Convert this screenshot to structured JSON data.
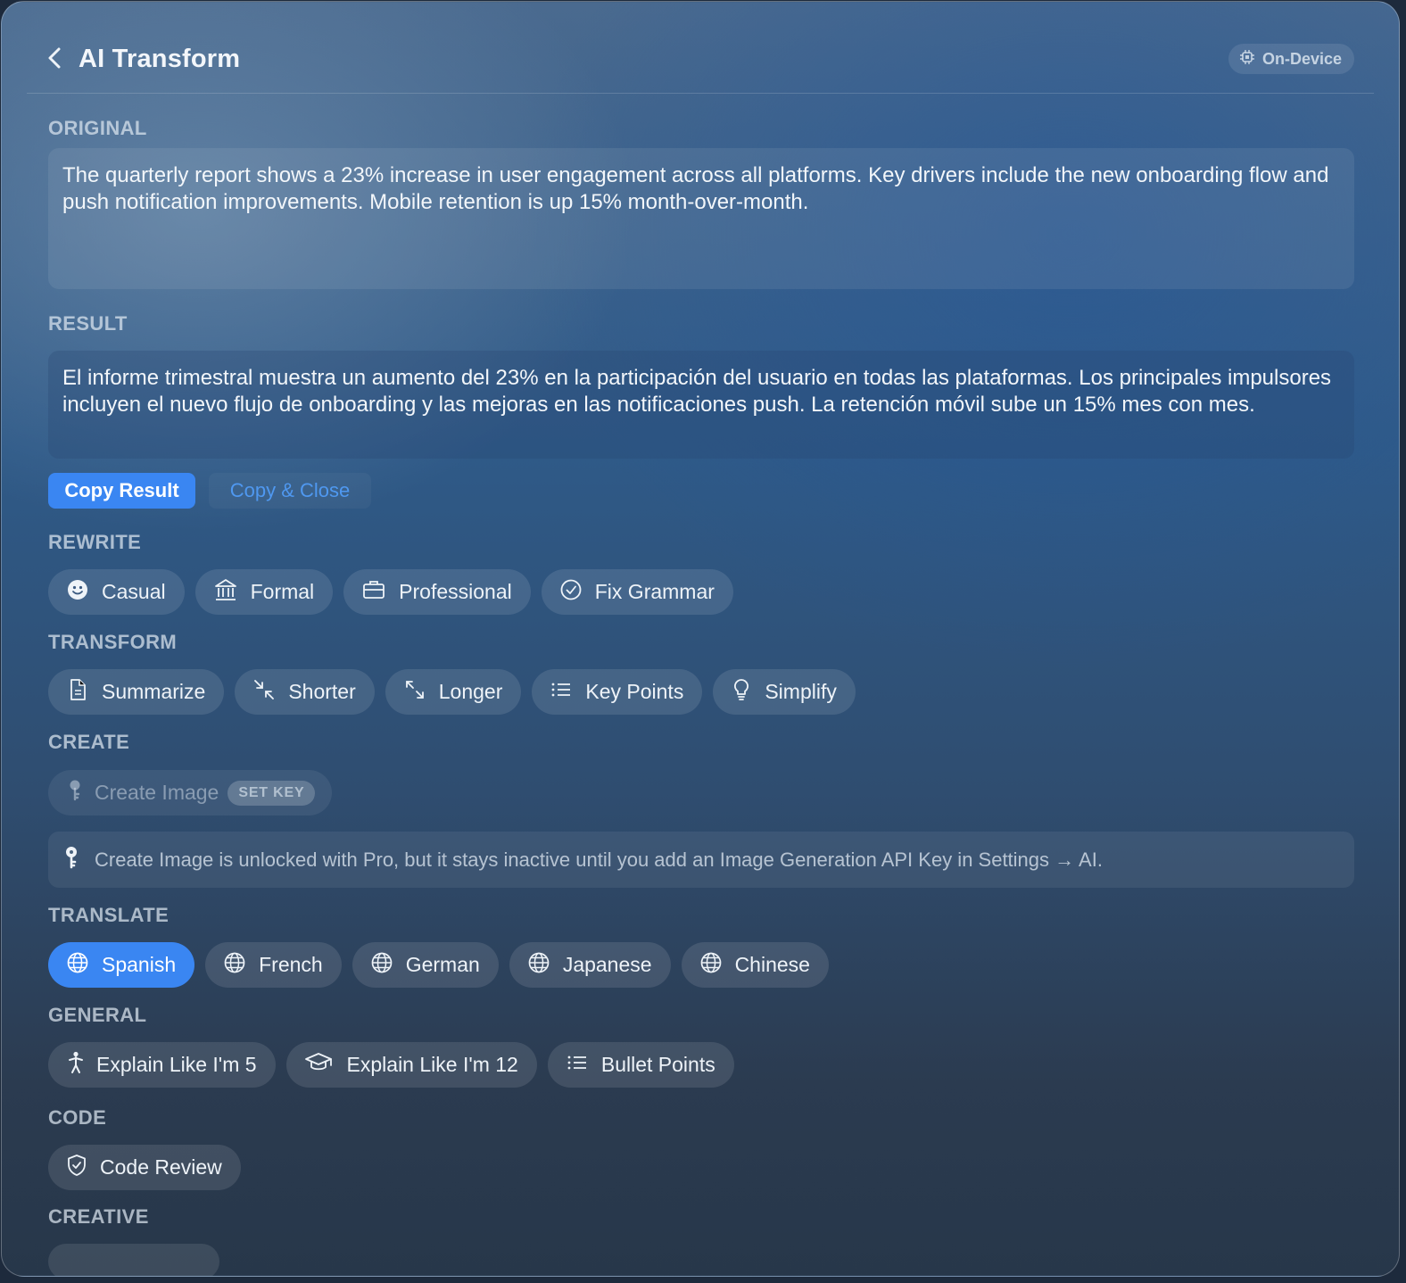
{
  "header": {
    "title": "AI Transform",
    "badge": "On-Device"
  },
  "original": {
    "label": "ORIGINAL",
    "text": "The quarterly report shows a 23% increase in user engagement across all platforms. Key drivers include the new onboarding flow and push notification improvements. Mobile retention is up 15% month-over-month."
  },
  "result": {
    "label": "RESULT",
    "text": "El informe trimestral muestra un aumento del 23% en la participación del usuario en todas las plataformas. Los principales impulsores incluyen el nuevo flujo de onboarding y las mejoras en las notificaciones push. La retención móvil sube un 15% mes con mes."
  },
  "actions": {
    "copy_result": "Copy Result",
    "copy_close": "Copy & Close"
  },
  "rewrite": {
    "label": "REWRITE",
    "items": [
      {
        "label": "Casual",
        "icon": "smiley-icon"
      },
      {
        "label": "Formal",
        "icon": "building-columns-icon"
      },
      {
        "label": "Professional",
        "icon": "briefcase-icon"
      },
      {
        "label": "Fix Grammar",
        "icon": "checkmark-circle-icon"
      }
    ]
  },
  "transform": {
    "label": "TRANSFORM",
    "items": [
      {
        "label": "Summarize",
        "icon": "document-icon"
      },
      {
        "label": "Shorter",
        "icon": "arrows-inward-icon"
      },
      {
        "label": "Longer",
        "icon": "arrows-outward-icon"
      },
      {
        "label": "Key Points",
        "icon": "list-icon"
      },
      {
        "label": "Simplify",
        "icon": "lightbulb-icon"
      }
    ]
  },
  "create": {
    "label": "CREATE",
    "item": {
      "label": "Create Image",
      "icon": "key-icon",
      "tag": "SET KEY"
    },
    "notice": "Create Image is unlocked with Pro, but it stays inactive until you add an Image Generation API Key in Settings → AI."
  },
  "translate": {
    "label": "TRANSLATE",
    "items": [
      {
        "label": "Spanish",
        "icon": "globe-icon",
        "selected": true
      },
      {
        "label": "French",
        "icon": "globe-icon"
      },
      {
        "label": "German",
        "icon": "globe-icon"
      },
      {
        "label": "Japanese",
        "icon": "globe-icon"
      },
      {
        "label": "Chinese",
        "icon": "globe-icon"
      }
    ]
  },
  "general": {
    "label": "GENERAL",
    "items": [
      {
        "label": "Explain Like I'm 5",
        "icon": "figure-walk-icon"
      },
      {
        "label": "Explain Like I'm 12",
        "icon": "graduation-cap-icon"
      },
      {
        "label": "Bullet Points",
        "icon": "list-icon"
      }
    ]
  },
  "code": {
    "label": "CODE",
    "items": [
      {
        "label": "Code Review",
        "icon": "shield-check-icon"
      }
    ]
  },
  "creative": {
    "label": "CREATIVE"
  },
  "colors": {
    "accent": "#3a86f2",
    "secondary_link": "#4f98f0"
  }
}
